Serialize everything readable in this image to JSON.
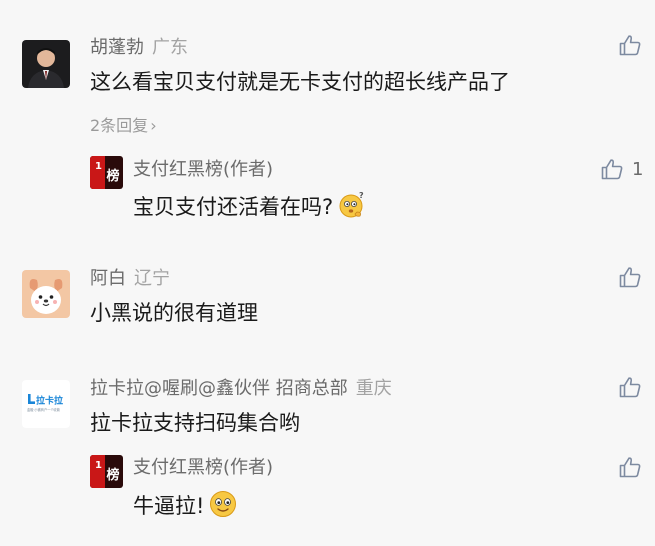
{
  "comments": [
    {
      "author": "胡蓬勃",
      "location": "广东",
      "text": "这么看宝贝支付就是无卡支付的超长线产品了",
      "replies_link": "2条回复",
      "replies_chevron": "›",
      "avatar_icon": "person-photo-avatar",
      "reply": {
        "author": "支付红黑榜(作者)",
        "avatar_text": "榜",
        "text": "宝贝支付还活着在吗?",
        "emoji": "thinking-face-emoji",
        "like_count": "1"
      }
    },
    {
      "author": "阿白",
      "location": "辽宁",
      "text": "小黑说的很有道理",
      "avatar_icon": "puppy-avatar"
    },
    {
      "author": "拉卡拉@喔刷@鑫伙伴 招商总部",
      "location": "重庆",
      "text": "拉卡拉支持扫码集合哟",
      "avatar_logo_text": "拉卡拉",
      "avatar_tagline": "金融·小微商户一个收款",
      "reply": {
        "author": "支付红黑榜(作者)",
        "avatar_text": "榜",
        "text": "牛逼拉!",
        "emoji": "smiling-face-emoji"
      }
    }
  ],
  "colors": {
    "background": "#f7f7f7",
    "like_icon": "#7d8aa0",
    "author_brand": "#d21b1b"
  }
}
